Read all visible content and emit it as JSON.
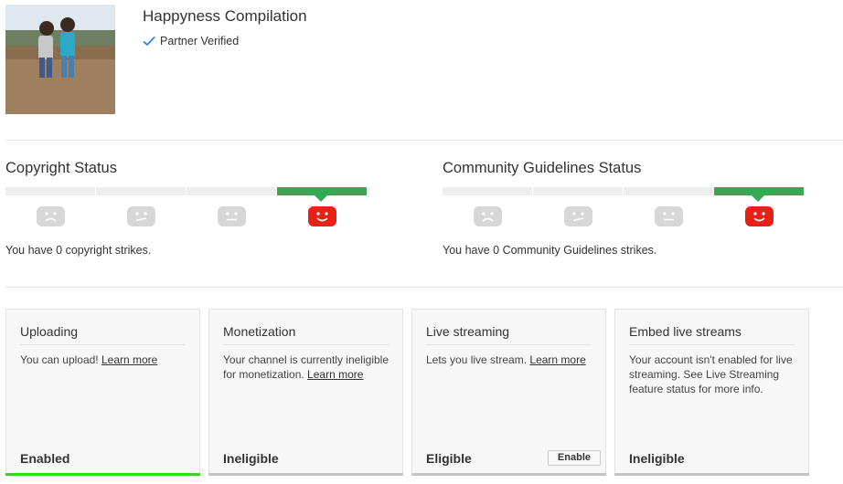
{
  "channel": {
    "title": "Happyness Compilation",
    "verified_label": "Partner Verified",
    "verified_icon": "checkmark-icon"
  },
  "copyright": {
    "title": "Copyright Status",
    "message": "You have 0 copyright strikes.",
    "faces": [
      "sad-face-icon",
      "meh-face-icon",
      "neutral-face-icon",
      "happy-face-icon"
    ],
    "active_level": 4
  },
  "community": {
    "title": "Community Guidelines Status",
    "message": "You have 0 Community Guidelines strikes.",
    "faces": [
      "sad-face-icon",
      "meh-face-icon",
      "neutral-face-icon",
      "happy-face-icon"
    ],
    "active_level": 4
  },
  "colors": {
    "good": "#34a853",
    "youtube_red": "#e62117",
    "enabled_underline": "#3ecf2b"
  },
  "features": [
    {
      "title": "Uploading",
      "text": "You can upload! ",
      "link": "Learn more",
      "status": "Enabled"
    },
    {
      "title": "Monetization",
      "text": "Your channel is currently ineligible for monetization. ",
      "link": "Learn more",
      "status": "Ineligible"
    },
    {
      "title": "Live streaming",
      "text": "Lets you live stream. ",
      "link": "Learn more",
      "status": "Eligible",
      "button": "Enable"
    },
    {
      "title": "Embed live streams",
      "text": "Your account isn't enabled for live streaming. See Live Streaming feature status for more info.",
      "link": "",
      "status": "Ineligible"
    }
  ]
}
